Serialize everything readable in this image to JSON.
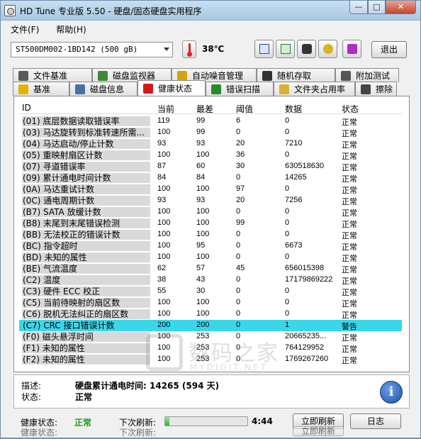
{
  "window": {
    "title": "HD Tune 专业版 5.50 - 硬盘/固态硬盘实用程序",
    "min": "—",
    "max": "□",
    "close": "✕"
  },
  "menu": [
    "文件(F)",
    "帮助(H)"
  ],
  "toolbar": {
    "drive": "ST500DM002-1BD142 (500 gB)",
    "temperature": "38℃",
    "exit_label": "退出",
    "icons": [
      "copy-info-icon",
      "copy-all-icon",
      "screenshot-camera-icon",
      "options-key-icon",
      "save-download-icon"
    ]
  },
  "tabs_row1": [
    {
      "label": "文件基准",
      "icon": "file-benchmark-icon",
      "color": "#5a5a5a"
    },
    {
      "label": "磁盘监视器",
      "icon": "disk-monitor-icon",
      "color": "#3a8a3a"
    },
    {
      "label": "自动噪音管理",
      "icon": "speaker-icon",
      "color": "#d9a400"
    },
    {
      "label": "随机存取",
      "icon": "random-access-icon",
      "color": "#333333"
    },
    {
      "label": "附加测试",
      "icon": "extra-tests-icon",
      "color": "#555555"
    }
  ],
  "tabs_row2": [
    {
      "label": "基准",
      "icon": "benchmark-bulb-icon",
      "color": "#e2b400"
    },
    {
      "label": "磁盘信息",
      "icon": "disk-info-icon",
      "color": "#4a6fa8"
    },
    {
      "label": "健康状态",
      "icon": "health-cross-icon",
      "color": "#d11a1a"
    },
    {
      "label": "错误扫描",
      "icon": "error-scan-icon",
      "color": "#2a8a2a"
    },
    {
      "label": "文件夹占用率",
      "icon": "folder-usage-icon",
      "color": "#d8b22e"
    },
    {
      "label": "擦除",
      "icon": "erase-trash-icon",
      "color": "#444444"
    }
  ],
  "table": {
    "headers": [
      "ID",
      "当前",
      "最差",
      "阈值",
      "数据",
      "状态"
    ],
    "rows": [
      [
        "(01) 底层数据读取错误率",
        "119",
        "99",
        "6",
        "0",
        "正常"
      ],
      [
        "(03) 马达旋转到标准转速所需...",
        "100",
        "99",
        "0",
        "0",
        "正常"
      ],
      [
        "(04) 马达启动/停止计数",
        "93",
        "93",
        "20",
        "7210",
        "正常"
      ],
      [
        "(05) 重映射扇区计数",
        "100",
        "100",
        "36",
        "0",
        "正常"
      ],
      [
        "(07) 寻道错误率",
        "87",
        "60",
        "30",
        "630518630",
        "正常"
      ],
      [
        "(09) 累计通电时间计数",
        "84",
        "84",
        "0",
        "14265",
        "正常"
      ],
      [
        "(0A) 马达重试计数",
        "100",
        "100",
        "97",
        "0",
        "正常"
      ],
      [
        "(0C) 通电周期计数",
        "93",
        "93",
        "20",
        "7256",
        "正常"
      ],
      [
        "(B7) SATA 放缓计数",
        "100",
        "100",
        "0",
        "0",
        "正常"
      ],
      [
        "(B8) 末尾到末尾错误检测",
        "100",
        "100",
        "99",
        "0",
        "正常"
      ],
      [
        "(BB) 无法校正的错误计数",
        "100",
        "100",
        "0",
        "0",
        "正常"
      ],
      [
        "(BC) 指令超时",
        "100",
        "95",
        "0",
        "6673",
        "正常"
      ],
      [
        "(BD) 未知的属性",
        "100",
        "100",
        "0",
        "0",
        "正常"
      ],
      [
        "(BE) 气流温度",
        "62",
        "57",
        "45",
        "656015398",
        "正常"
      ],
      [
        "(C2) 温度",
        "38",
        "43",
        "0",
        "17179869222",
        "正常"
      ],
      [
        "(C3) 硬件 ECC 校正",
        "55",
        "30",
        "0",
        "0",
        "正常"
      ],
      [
        "(C5) 当前待映射的扇区数",
        "100",
        "100",
        "0",
        "0",
        "正常"
      ],
      [
        "(C6) 脱机无法纠正的扇区数",
        "100",
        "100",
        "0",
        "0",
        "正常"
      ],
      [
        "(C7) CRC 接口错误计数",
        "200",
        "200",
        "0",
        "1",
        "警告"
      ],
      [
        "(F0) 磁头悬浮时间",
        "100",
        "253",
        "0",
        "20665235...",
        "正常"
      ],
      [
        "(F1) 未知的属性",
        "100",
        "253",
        "0",
        "764129952",
        "正常"
      ],
      [
        "(F2) 未知的属性",
        "100",
        "253",
        "0",
        "1769267260",
        "正常"
      ]
    ],
    "selected_index": 18,
    "selection_color": "#3ad7ea"
  },
  "detail": {
    "desc_label": "描述:",
    "desc_value": "硬盘累计通电时间: 14265 (594 天)",
    "status_label": "状态:",
    "status_value": "正常"
  },
  "statusbar": {
    "health_label": "健康状态:",
    "health_value": "正常",
    "health_color": "#1b9a1b",
    "refresh_label": "下次刷新:",
    "progress_fraction": 0.05,
    "countdown": "4:44",
    "refresh_button": "立即刷新",
    "log_button": "日志"
  },
  "ghost": {
    "label": "健康状态:",
    "refresh_label": "下次刷新:",
    "button": "立即刷新"
  },
  "watermark": {
    "cn": "数码之家",
    "en": "MYDIGIT.NET"
  }
}
